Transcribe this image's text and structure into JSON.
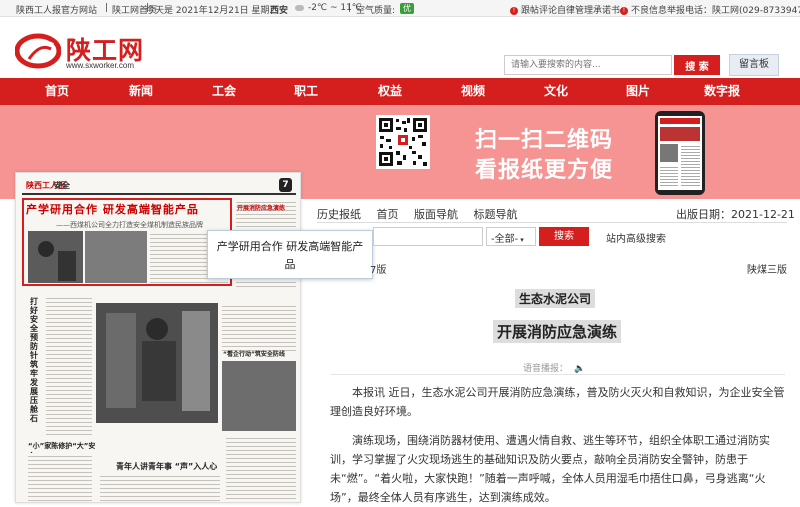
{
  "topbar": {
    "site_links": [
      "陕西工人报官方网站",
      "陕工网首页"
    ],
    "date": "今天是 2021年12月21日 星期二",
    "city": "西安",
    "temp": "-2℃ ~ 11℃",
    "air_label": "空气质量:",
    "air_value": "优",
    "notice1": "新闻单位自律承诺书",
    "notice1_visible": "跟帖评论自律管理承诺书",
    "notice2": "不良信息举报电话：陕工网(029-87339475)"
  },
  "header": {
    "logo_text": "陕工网",
    "logo_url": "www.sxworker.com",
    "search_placeholder": "请输入要搜索的内容...",
    "search_button": "搜 索",
    "guestbook": "留言板"
  },
  "nav": {
    "items": [
      "首页",
      "新闻",
      "工会",
      "职工",
      "权益",
      "视频",
      "文化",
      "图片",
      "数字报"
    ]
  },
  "banner": {
    "line1": "扫一扫二维码",
    "line2": "看报纸更方便"
  },
  "paper": {
    "brand": "陕西工人报",
    "section": "安全",
    "page_no": "7",
    "title": "产学研用合作  研发高端智能产品",
    "subtitle": "——西煤机公司全力打造安全煤机制造民族品牌",
    "col_titles": [
      "打好安全预防针 筑牢发展压舱石",
      "“小”家陈修护“大”安全",
      "青年人讲青年事 “声”入人心",
      "开展消防应急演练",
      "“看企行动”筑安全防线"
    ]
  },
  "tooltip": {
    "text": "产学研用合作  研发高端智能产品"
  },
  "reader": {
    "nav": [
      "历史报纸",
      "首页",
      "版面导航",
      "标题导航"
    ],
    "date": "出版日期：2021-12-21",
    "select": "-全部-",
    "search_button": "搜索",
    "advanced": "站内高级搜索",
    "page_left": "7版",
    "page_right": "陕煤三版",
    "kicker": "生态水泥公司",
    "headline": "开展消防应急演练",
    "voice_label": "语音播报：",
    "paragraphs": [
      "本报讯  近日，生态水泥公司开展消防应急演练，普及防火灭火和自救知识，为企业安全管理创造良好环境。",
      "演练现场，围绕消防器材使用、遭遇火情自救、逃生等环节，组织全体职工通过消防实训，学习掌握了火灾现场逃生的基础知识及防火要点，敲响全员消防安全警钟，防患于未“燃”。“着火啦，大家快跑！”随着一声呼喊，全体人员用湿毛巾捂住口鼻，弓身逃离“火场”，最终全体人员有序逃生，达到演练成效。"
    ]
  },
  "colors": {
    "brand_red": "#d51f1f",
    "banner_pink": "#f59493"
  }
}
